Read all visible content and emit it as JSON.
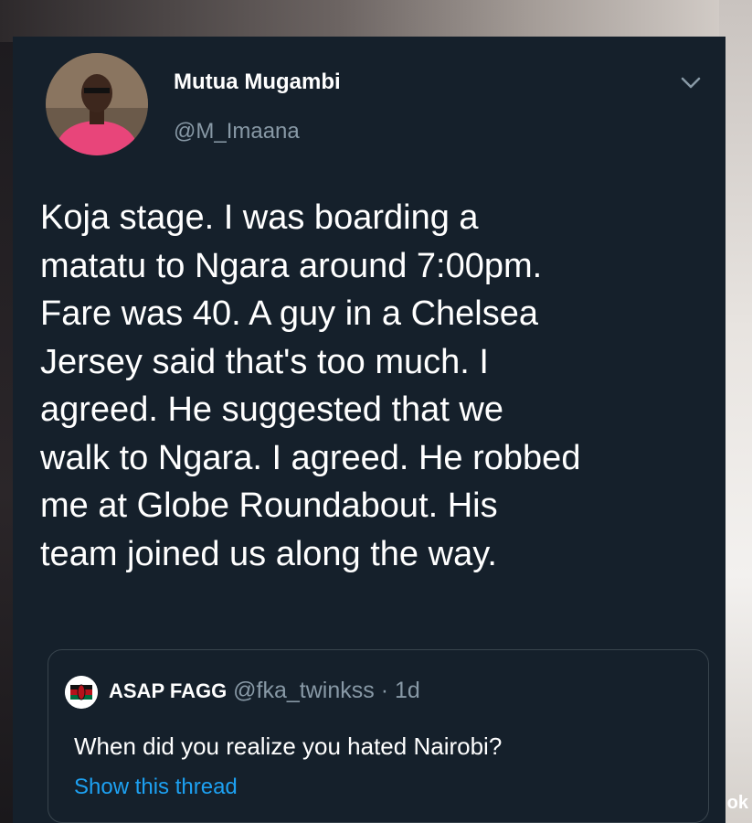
{
  "tweet": {
    "author": {
      "display_name": "Mutua Mugambi",
      "handle": "@M_Imaana",
      "avatar_icon": "profile-photo"
    },
    "menu_icon": "chevron-down-icon",
    "text": "Koja stage. I was boarding a\nmatatu to Ngara around 7:00pm.\nFare was 40. A guy in a Chelsea\nJersey  said that's too much. I\nagreed. He suggested that we\nwalk to Ngara. I agreed. He robbed\nme at Globe Roundabout. His\nteam joined us along the way.",
    "quoted": {
      "display_name": "ASAP FAGG",
      "handle": "@fka_twinkss",
      "separator": "·",
      "time": "1d",
      "text": "When did you realize you hated Nairobi?",
      "link": "Show this thread",
      "avatar_icon": "kenya-flag-avatar"
    }
  },
  "background": {
    "corner_text": "ok"
  },
  "colors": {
    "card_bg": "#15202b",
    "text_primary": "#ffffff",
    "text_secondary": "#8899a6",
    "link": "#1da1f2",
    "border": "#38444d"
  }
}
